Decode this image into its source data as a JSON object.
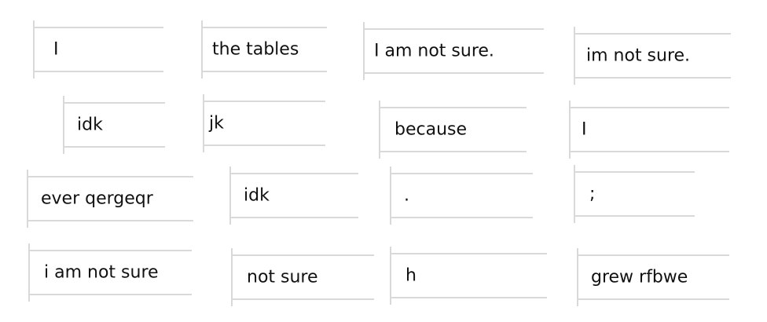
{
  "responses": [
    "I",
    "the tables",
    "I am not sure.",
    "im not sure.",
    "idk",
    "jk",
    "because",
    "I",
    "ever qergeqr",
    "idk",
    ".",
    ";",
    "i am not sure",
    "not sure",
    "h",
    "grew rfbwe"
  ]
}
